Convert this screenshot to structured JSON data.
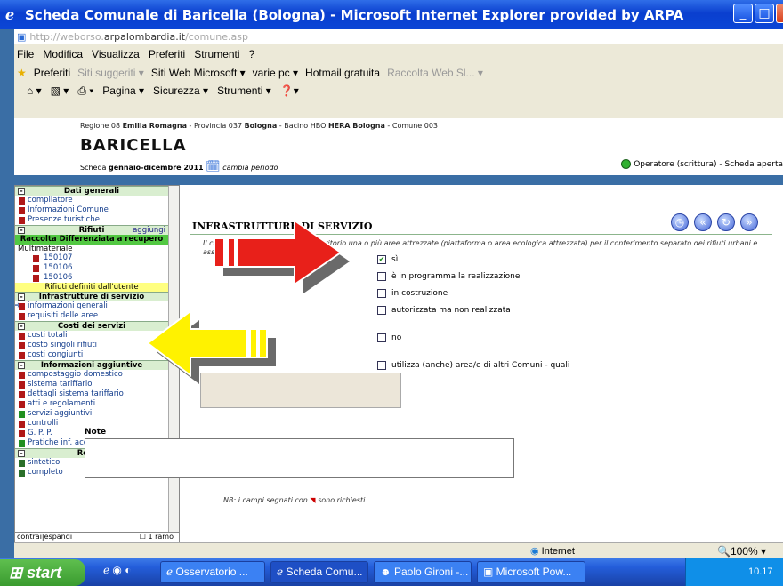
{
  "window": {
    "title": "Scheda Comunale di Baricella (Bologna) - Microsoft Internet Explorer provided by ARPA",
    "address_host": "http://weborso.",
    "address_domain": "arpalombardia.it",
    "address_path": "/comune.asp"
  },
  "menu": [
    "File",
    "Modifica",
    "Visualizza",
    "Preferiti",
    "Strumenti",
    "?"
  ],
  "favorites": {
    "label": "Preferiti",
    "items": [
      "Siti suggeriti ▾",
      "Siti Web Microsoft ▾",
      "varie pc ▾",
      "Hotmail gratuita",
      "Raccolta Web Sl... ▾"
    ]
  },
  "commandbar": [
    "Pagina ▾",
    "Sicurezza ▾",
    "Strumenti ▾"
  ],
  "header": {
    "breadcrumb_1": "Regione 08 ",
    "breadcrumb_2": "Emilia Romagna",
    "breadcrumb_3": " - Provincia 037 ",
    "breadcrumb_4": "Bologna",
    "breadcrumb_5": " - Bacino HBO ",
    "breadcrumb_6": "HERA Bologna",
    "breadcrumb_7": " - Comune 003",
    "town": "BARICELLA",
    "scheda_label": "Scheda ",
    "scheda_period": "gennaio-dicembre 2011",
    "change_period": "cambia periodo",
    "operator": "Operatore (scrittura) - Scheda aperta"
  },
  "sidebar": {
    "dati_generali": "Dati generali",
    "items_dati": [
      "compilatore",
      "Informazioni Comune",
      "Presenze turistiche"
    ],
    "rifiuti": "Rifiuti",
    "aggiungi": "aggiungi",
    "raccolta": "Raccolta Differenziata a recupero",
    "multimateriale": "Multimateriale",
    "codes": [
      "150107",
      "150106",
      "150106"
    ],
    "user_defined": "Rifiuti definiti dall'utente",
    "infrastrutture": "Infrastrutture di servizio",
    "items_infra": [
      "informazioni generali",
      "requisiti delle aree"
    ],
    "costi": "Costi dei servizi",
    "items_costi": [
      "costi totali",
      "costo singoli rifiuti",
      "costi congiunti"
    ],
    "info_agg": "Informazioni aggiuntive",
    "items_info": [
      "compostaggio domestico",
      "sistema tariffario",
      "dettagli sistema tariffario",
      "atti e regolamenti",
      "servizi aggiuntivi",
      "controlli",
      "G. P. P.",
      "Pratiche inf. acq. verde"
    ],
    "report": "Report",
    "items_report": [
      "sintetico",
      "completo"
    ],
    "footer_left": "contrai|espandi",
    "footer_right": "1 ramo"
  },
  "main": {
    "section_title": "INFRASTRUTTURE DI SERVIZIO",
    "question": "Il comune possiede nel proprio territorio una o più aree attrezzate (piattaforma o area ecologica attrezzata) per il conferimento separato dei rifiuti urbani e assimilati, ivi compreso?",
    "options": [
      "sì",
      "è in programma la realizzazione",
      "in costruzione",
      "autorizzata ma non realizzata",
      "no",
      "utilizza (anche) area/e di altri Comuni - quali"
    ],
    "note_label": "Note",
    "nb_prefix": "NB: i campi segnati con ",
    "nb_suffix": " sono richiesti."
  },
  "status": {
    "zone": "Internet",
    "zoom": "100%"
  },
  "taskbar": {
    "start": "start",
    "tasks": [
      "Osservatorio ...",
      "Scheda Comu...",
      "Paolo Gironi -...",
      "Microsoft Pow..."
    ],
    "clock": "10.17"
  }
}
